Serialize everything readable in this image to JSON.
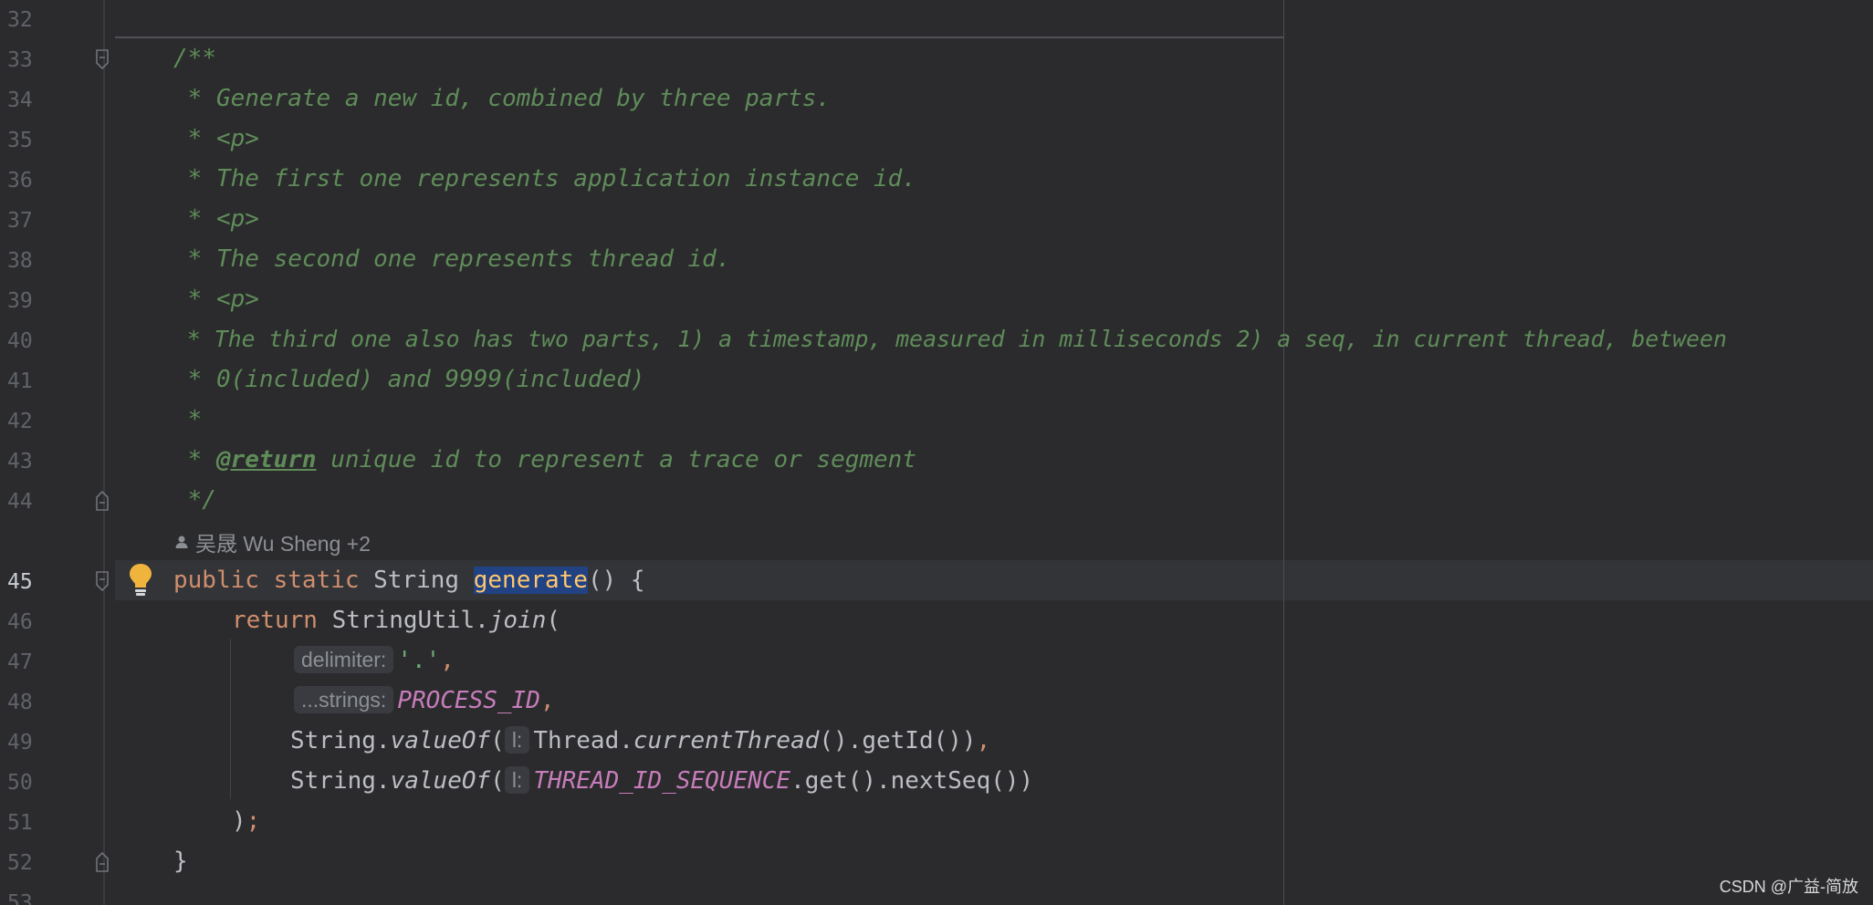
{
  "gutter": {
    "line_numbers": [
      "32",
      "33",
      "34",
      "35",
      "36",
      "37",
      "38",
      "39",
      "40",
      "41",
      "42",
      "43",
      "44",
      "45",
      "46",
      "47",
      "48",
      "49",
      "50",
      "51",
      "52",
      "53"
    ],
    "current_line": "45"
  },
  "code": {
    "doc": {
      "l33": "/**",
      "l34": " * Generate a new id, combined by three parts.",
      "l35": " * <p>",
      "l36": " * The first one represents application instance id.",
      "l37": " * <p>",
      "l38": " * The second one represents thread id.",
      "l39": " * <p>",
      "l40": " * The third one also has two parts, 1) a timestamp, measured in milliseconds 2) a seq, in current thread, between",
      "l41": " * 0(included) and 9999(included)",
      "l42": " *",
      "l43_star": " * ",
      "l43_tag": "@return",
      "l43_rest": " unique id to represent a trace or segment",
      "l44": " */"
    },
    "author_hint": "吴晟 Wu Sheng +2",
    "l45": {
      "kw1": "public",
      "kw2": "static",
      "type": "String",
      "method": "generate",
      "tail": "() {"
    },
    "l46": {
      "kw": "return",
      "cls": "StringUtil.",
      "call": "join",
      "open": "("
    },
    "l47": {
      "hint": "delimiter:",
      "value": "'.'",
      "comma": ","
    },
    "l48": {
      "hint": "...strings:",
      "value": "PROCESS_ID",
      "comma": ","
    },
    "l49": {
      "cls": "String.",
      "call": "valueOf",
      "open": "(",
      "hint": "l:",
      "thread": "Thread.",
      "current": "currentThread",
      "rest": "().getId())",
      "comma": ","
    },
    "l50": {
      "cls": "String.",
      "call": "valueOf",
      "open": "(",
      "hint": "l:",
      "const": "THREAD_ID_SEQUENCE",
      "rest": ".get().nextSeq())"
    },
    "l51": {
      "close": ")",
      "semi": ";"
    },
    "l52": "}"
  },
  "watermark": "CSDN @广益-简放",
  "icons": {
    "fold": "fold-marker-icon",
    "bulb": "lightbulb-icon",
    "author": "person-icon"
  }
}
